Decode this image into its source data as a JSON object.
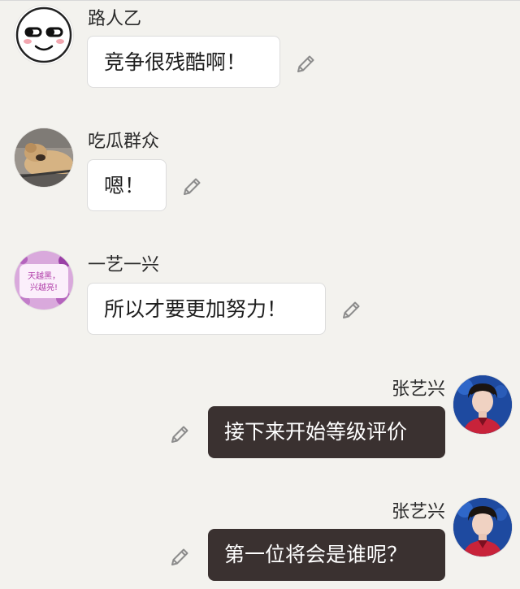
{
  "messages": [
    {
      "sender": "路人乙",
      "text": "竞争很残酷啊！",
      "side": "left",
      "avatar": "meme-face-avatar"
    },
    {
      "sender": "吃瓜群众",
      "text": "嗯！",
      "side": "left",
      "avatar": "dog-photo-avatar"
    },
    {
      "sender": "一艺一兴",
      "text": "所以才要更加努力！",
      "side": "left",
      "avatar": "slogan-sticker-avatar",
      "avatar_text": [
        "天越黑，",
        "兴越亮!"
      ]
    },
    {
      "sender": "张艺兴",
      "text": "接下来开始等级评价",
      "side": "right",
      "avatar": "man-portrait-avatar"
    },
    {
      "sender": "张艺兴",
      "text": "第一位将会是谁呢？",
      "side": "right",
      "avatar": "man-portrait-avatar"
    }
  ],
  "colors": {
    "background": "#f3f2ee",
    "incoming_bubble": "#ffffff",
    "outgoing_bubble": "#3a3130",
    "outgoing_text": "#ffffff"
  },
  "icons": {
    "edit": "pencil-icon"
  }
}
